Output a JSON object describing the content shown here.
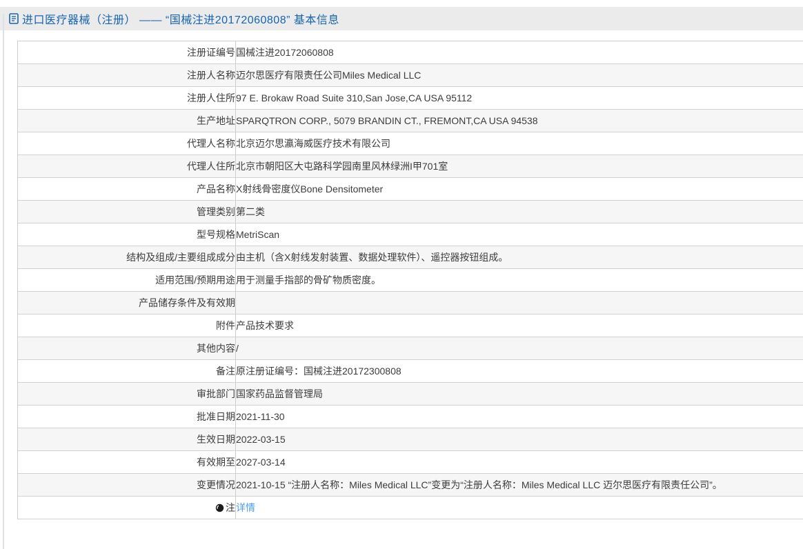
{
  "colors": {
    "title_blue": "#1663b2",
    "link_blue": "#4a9ceb",
    "header_band_bg": "#ebebeb",
    "row_alt_bg": "#f6f6f6",
    "table_border": "#cccccc",
    "text": "#3c3c3c"
  },
  "header": {
    "icon": "document-icon",
    "title": "进口医疗器械（注册） —— “国械注进20172060808” 基本信息"
  },
  "table": {
    "rows": [
      {
        "label": "注册证编号",
        "value": "国械注进20172060808"
      },
      {
        "label": "注册人名称",
        "value": "迈尔思医疗有限责任公司Miles Medical LLC"
      },
      {
        "label": "注册人住所",
        "value": "97 E. Brokaw Road Suite 310,San Jose,CA USA 95112"
      },
      {
        "label": "生产地址",
        "value": "SPARQTRON CORP., 5079 BRANDIN CT., FREMONT,CA USA 94538"
      },
      {
        "label": "代理人名称",
        "value": "北京迈尔思瀛海威医疗技术有限公司"
      },
      {
        "label": "代理人住所",
        "value": "北京市朝阳区大屯路科学园南里风林绿洲I甲701室"
      },
      {
        "label": "产品名称",
        "value": "X射线骨密度仪Bone Densitometer"
      },
      {
        "label": "管理类别",
        "value": "第二类"
      },
      {
        "label": "型号规格",
        "value": "MetriScan"
      },
      {
        "label": "结构及组成/主要组成成分",
        "value": "由主机（含X射线发射装置、数据处理软件）、遥控器按钮组成。"
      },
      {
        "label": "适用范围/预期用途",
        "value": "用于测量手指部的骨矿物质密度。"
      },
      {
        "label": "产品储存条件及有效期",
        "value": ""
      },
      {
        "label": "附件",
        "value": "产品技术要求"
      },
      {
        "label": "其他内容",
        "value": "/"
      },
      {
        "label": "备注",
        "value": "原注册证编号：国械注进20172300808"
      },
      {
        "label": "审批部门",
        "value": "国家药品监督管理局"
      },
      {
        "label": "批准日期",
        "value": "2021-11-30"
      },
      {
        "label": "生效日期",
        "value": "2022-03-15"
      },
      {
        "label": "有效期至",
        "value": "2027-03-14"
      },
      {
        "label": "变更情况",
        "value": "2021-10-15 “注册人名称：Miles Medical LLC”变更为“注册人名称：Miles Medical LLC 迈尔思医疗有限责任公司”。"
      },
      {
        "label": "注",
        "icon": "note-icon",
        "value": "详情",
        "value_is_link": true
      }
    ]
  }
}
